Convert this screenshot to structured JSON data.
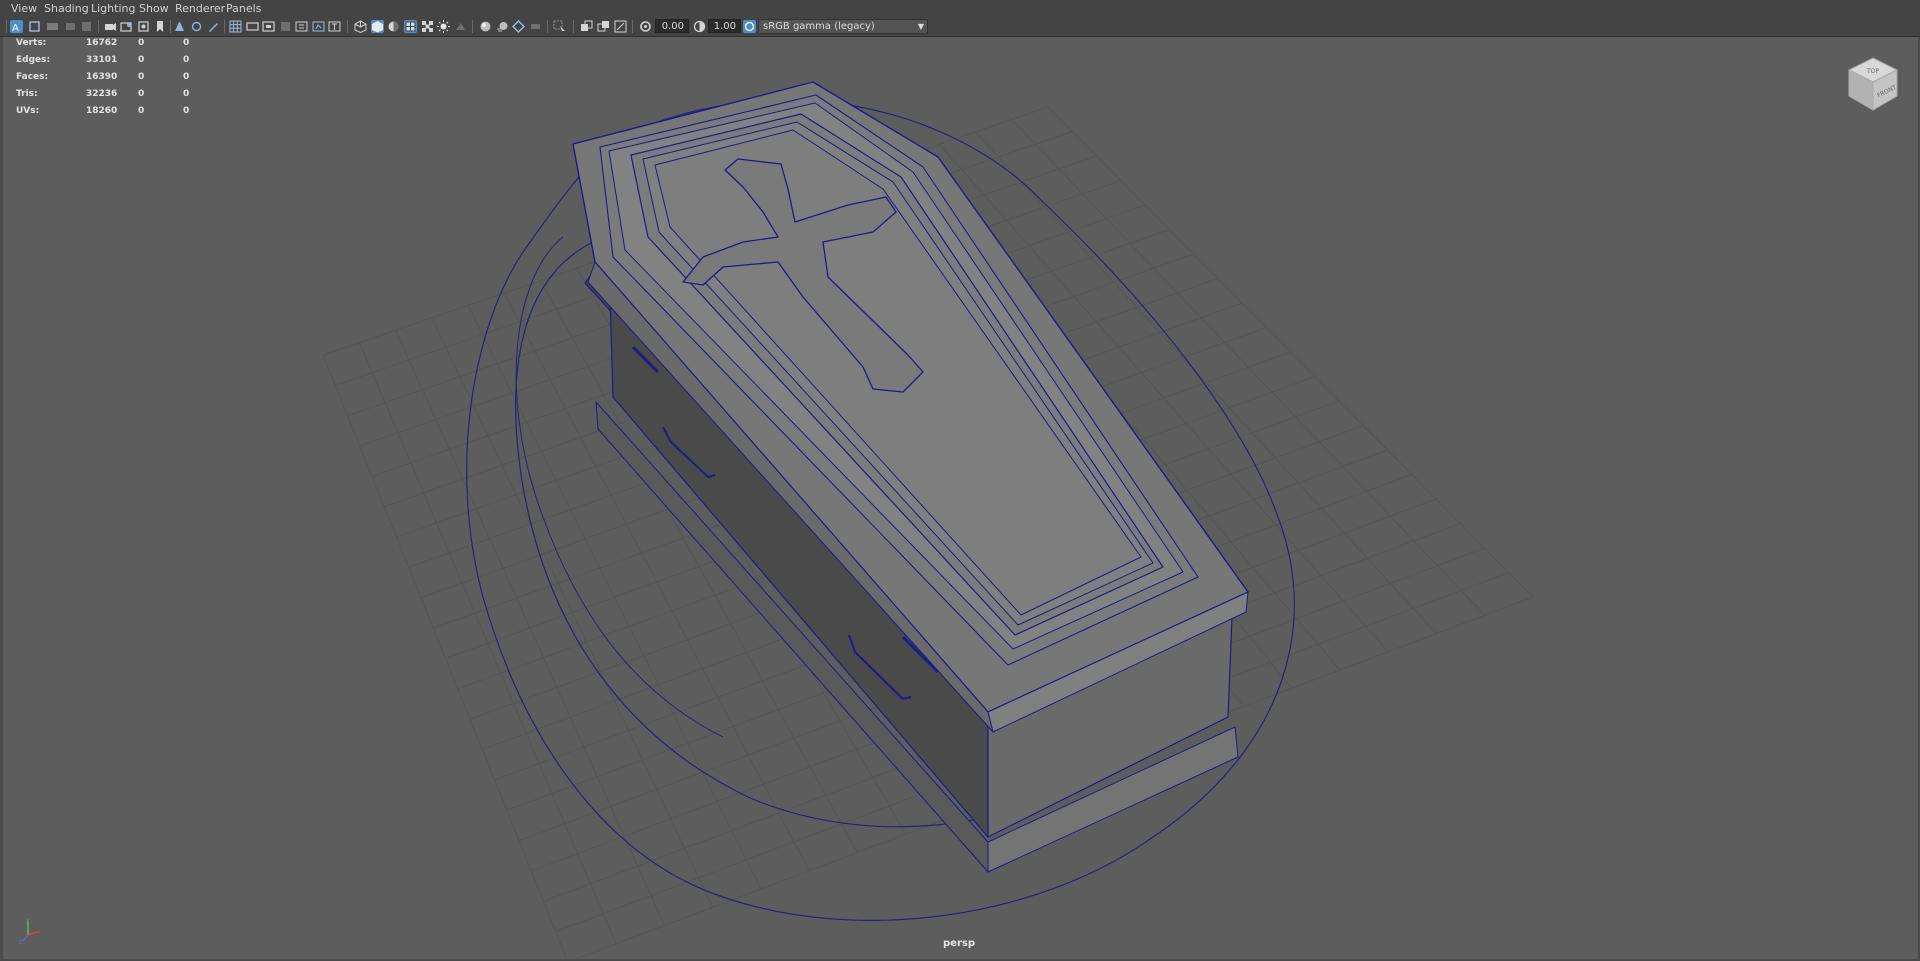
{
  "menu": {
    "items": [
      "View",
      "Shading",
      "Lighting",
      "Show",
      "Renderer",
      "Panels"
    ]
  },
  "toolbar": {
    "exposure_value": "0.00",
    "gamma_value": "1.00",
    "color_space": "sRGB gamma (legacy)"
  },
  "hud": {
    "rows": [
      {
        "label": "Verts:",
        "total": "16762",
        "selected": "0",
        "uv": "0"
      },
      {
        "label": "Edges:",
        "total": "33101",
        "selected": "0",
        "uv": "0"
      },
      {
        "label": "Faces:",
        "total": "16390",
        "selected": "0",
        "uv": "0"
      },
      {
        "label": "Tris:",
        "total": "32236",
        "selected": "0",
        "uv": "0"
      },
      {
        "label": "UVs:",
        "total": "18260",
        "selected": "0",
        "uv": "0"
      }
    ]
  },
  "viewcube": {
    "top_label": "TOP",
    "front_label": "FRONT"
  },
  "camera": {
    "name": "persp"
  },
  "axis": {
    "x": "x",
    "y": "y",
    "z": "z"
  },
  "colors": {
    "wire": "#1b1b8a",
    "accent": "#4f8ec7",
    "viewport_bg": "#5d5d5d"
  }
}
